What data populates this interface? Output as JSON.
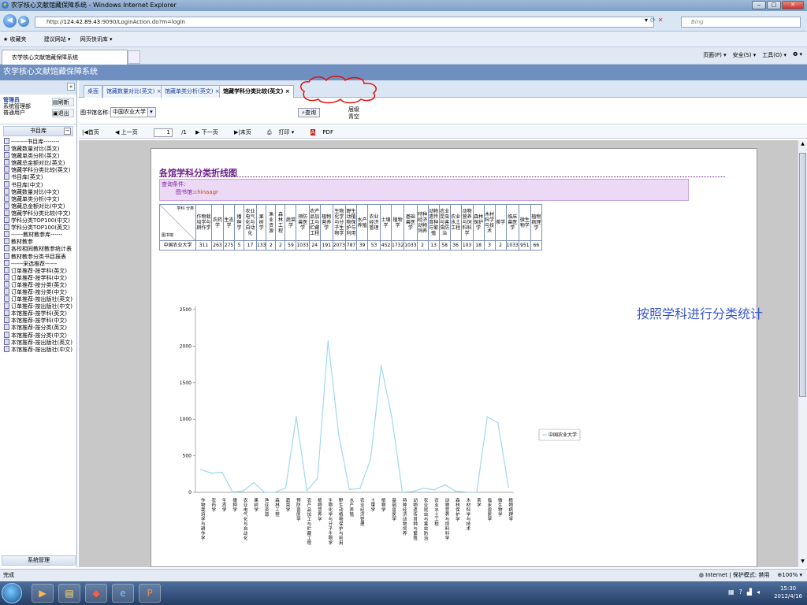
{
  "window": {
    "title": "农学核心文献馆藏保障系统 - Windows Internet Explorer",
    "controls": [
      "‒",
      "▢",
      "✕"
    ]
  },
  "browser": {
    "url_prefix": "http://",
    "url_host": "124.42.89.43",
    "url_rest": ":9090/LoginAction.do?m=login",
    "search_placeholder": "Bing",
    "favorites_label": "收藏夹",
    "fav_items": [
      "建议网站 ▾",
      "网页快讯库 ▾"
    ],
    "tab_label": "农学核心文献馆藏保障系统",
    "tools": [
      "页面(P) ▾",
      "安全(S) ▾",
      "工具(O) ▾",
      "❷ ▾"
    ]
  },
  "app": {
    "title": "农学核心文献馆藏保障系统"
  },
  "sidebar": {
    "user_name": "管理员",
    "user_lines": [
      "系统管理部",
      "普通用户"
    ],
    "btn_refresh": "刷新",
    "btn_logout": "退出",
    "section_title": "书目库",
    "items": [
      "--------书目库--------",
      "馆藏数量对比(英文)",
      "馆藏单类分析(英文)",
      "馆藏总金额对比(英文)",
      "馆藏学科分类比较(英文)",
      "书目库(英文)",
      "书目库(中文)",
      "馆藏数量对比(中文)",
      "馆藏单类分析(中文)",
      "馆藏总金额对比(中文)",
      "馆藏学科分类比较(中文)",
      "学科分类TOP100(中文)",
      "学科分类TOP100(英文)",
      "------教材教参库------",
      "教材教参",
      "各校相同教材教参统计表",
      "教材教参分类书目报表",
      "------采选推荐------",
      "订单推荐-按学科(英文)",
      "订单推荐-按学科(中文)",
      "订单推荐-按分类(英文)",
      "订单推荐-按分类(中文)",
      "订单推荐-按出版社(英文)",
      "订单推荐-按出版社(中文)",
      "本馆推荐-按学科(英文)",
      "本馆推荐-按学科(中文)",
      "本馆推荐-按分类(英文)",
      "本馆推荐-按分类(中文)",
      "本馆推荐-按出版社(英文)",
      "本馆推荐-按出版社(中文)"
    ],
    "bottom_section": "系统管理"
  },
  "main": {
    "tabs": [
      "桌面",
      "馆藏数量对比(英文)",
      "馆藏单类分析(英文)",
      "馆藏学科分类比较(英文)"
    ],
    "filter_label": "图书馆名称:",
    "filter_value": "中国农业大学",
    "query_button": "查询",
    "filter_level_label": "层级",
    "filter_level_value": "青空",
    "pager": {
      "first": "首页",
      "prev": "上一页",
      "page": "1",
      "total": "/1",
      "next": "下一页",
      "last": "末页",
      "print": "打印 ▾",
      "pdf": "PDF"
    }
  },
  "report": {
    "title": "各馆学科分类折线图",
    "cond_label": "查询条件:",
    "cond_key": "图书馆:",
    "cond_value": "chinaagr",
    "corner_top": "学科 分类",
    "corner_bottom": "图书馆",
    "annotation": "按照学科进行分类统计"
  },
  "chart_data": {
    "type": "line",
    "series": [
      {
        "name": "中国农业大学",
        "values": [
          311,
          263,
          275,
          5,
          17,
          133,
          2,
          2,
          59,
          1033,
          24,
          191,
          2073,
          787,
          39,
          53,
          452,
          1732,
          1033,
          2,
          13,
          58,
          36,
          103,
          18,
          3,
          2,
          1033,
          951,
          66
        ]
      }
    ],
    "categories": [
      "作物栽培学与耕作学",
      "农药学",
      "生态学",
      "播种学",
      "农业电气化与自动化",
      "果树学",
      "渔业资源",
      "森林工程",
      "蔬菜学",
      "预防兽医学",
      "农产品加工与贮藏工程",
      "植物营养学",
      "生物化学与分子生物学",
      "野生动植物保护与利用",
      "水产养殖",
      "农业经济管理",
      "土壤学",
      "植物学",
      "基础兽医学",
      "特种经济动物饲养",
      "动物遗传育种与繁殖",
      "农业昆虫与害虫防治",
      "农业水土工程",
      "动物营养与饲料科学",
      "森林保护学",
      "木材科学与技术",
      "茶学",
      "临床兽医学",
      "微生物学",
      "植物病理学"
    ],
    "y_ticks": [
      "0",
      "500",
      "1000",
      "1500",
      "2000",
      "2500"
    ],
    "ylim": [
      0,
      2500
    ],
    "legend_position": "right",
    "line_color": "#9fd8f0"
  },
  "statusbar": {
    "left": "完成",
    "zone": "Internet | 保护模式: 禁用",
    "zoom": "100%"
  },
  "taskbar": {
    "time": "15:30",
    "date": "2012/4/16"
  }
}
